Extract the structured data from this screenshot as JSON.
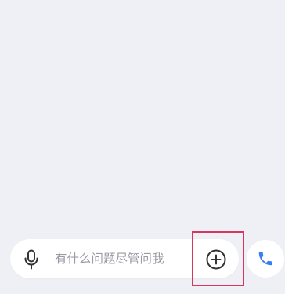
{
  "chat_input": {
    "placeholder": "有什么问题尽管问我",
    "value": ""
  },
  "icons": {
    "mic": "microphone-icon",
    "plus": "plus-circle-icon",
    "phone": "phone-icon"
  },
  "colors": {
    "background": "#eff0f5",
    "bar": "#ffffff",
    "icon_dark": "#333333",
    "placeholder": "#9a9ca3",
    "highlight": "#d8365e",
    "phone_blue": "#3a7ef5"
  }
}
